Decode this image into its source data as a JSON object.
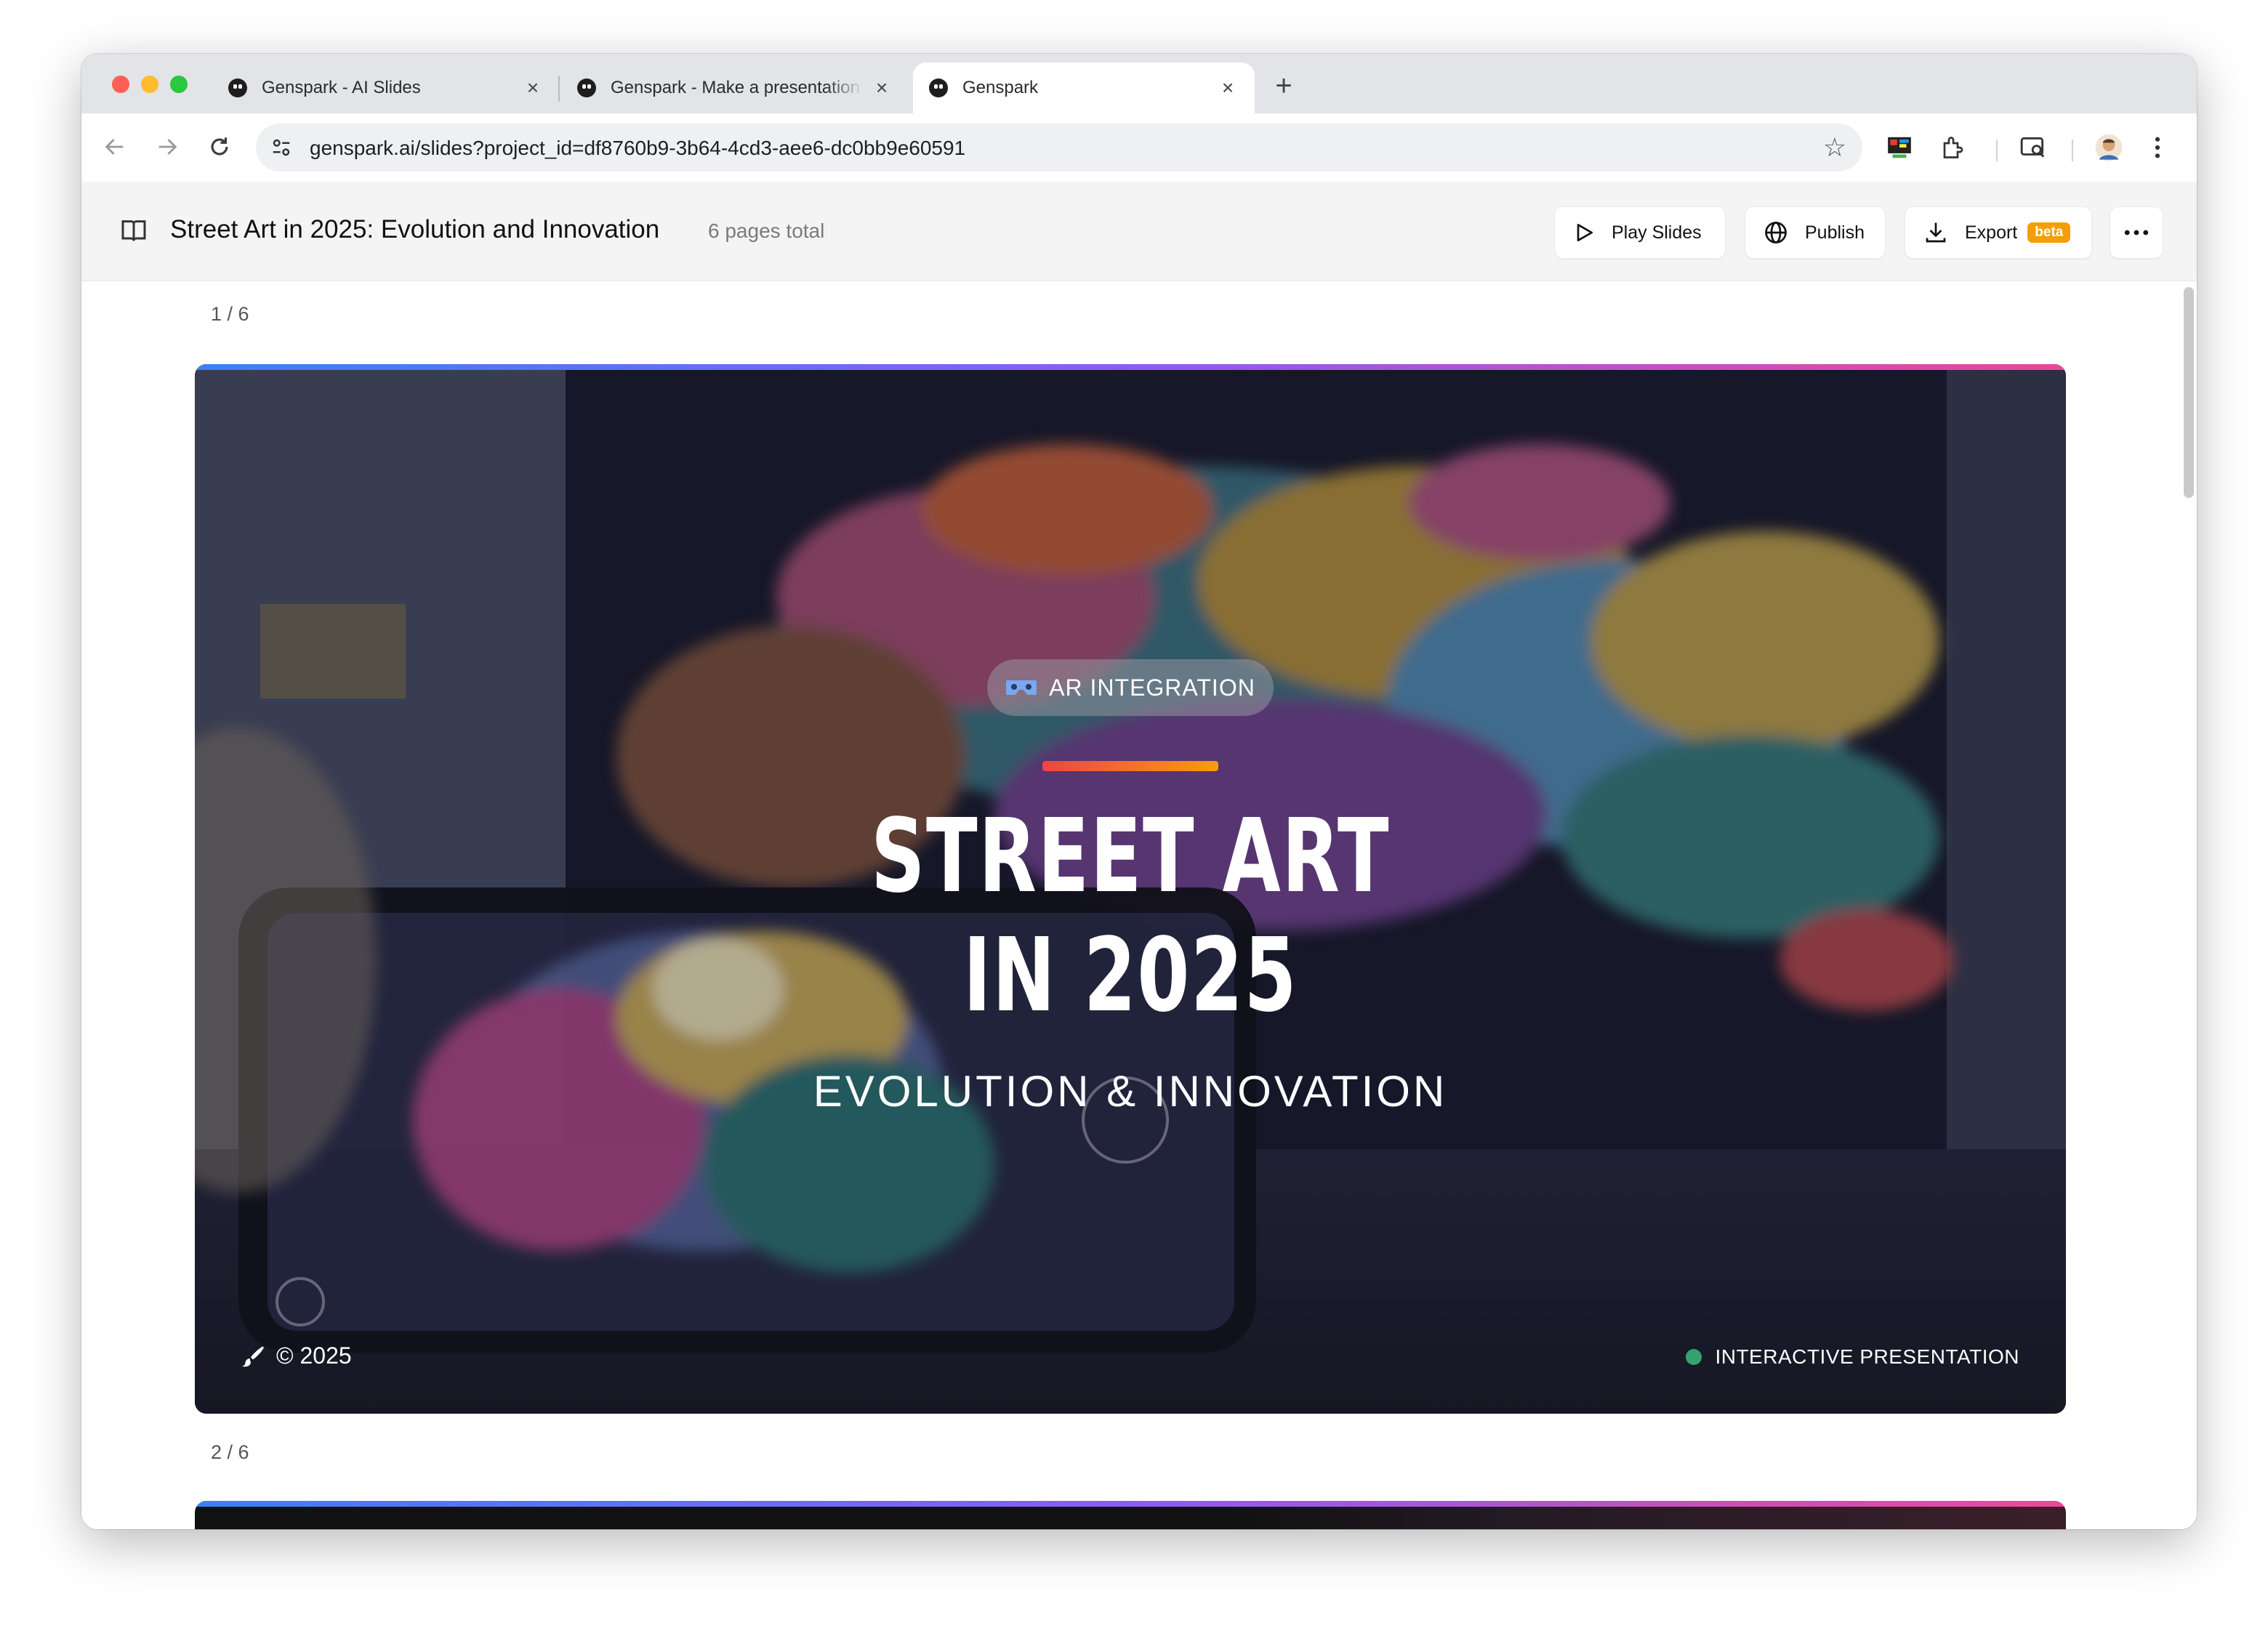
{
  "browser": {
    "tabs": [
      {
        "title": "Genspark - AI Slides"
      },
      {
        "title": "Genspark - Make a presentation"
      },
      {
        "title": "Genspark"
      }
    ],
    "new_tab_symbol": "+",
    "close_symbol": "×",
    "url": "genspark.ai/slides?project_id=df8760b9-3b64-4cd3-aee6-dc0bb9e60591"
  },
  "app": {
    "title": "Street Art in 2025: Evolution and Innovation",
    "pages_total": "6 pages total",
    "buttons": {
      "play": "Play Slides",
      "publish": "Publish",
      "export": "Export",
      "export_badge": "beta"
    }
  },
  "slides": [
    {
      "page_label": "1 / 6",
      "pill_label": "AR INTEGRATION",
      "headline_line1": "STREET ART",
      "headline_line2": "IN 2025",
      "subtitle": "EVOLUTION & INNOVATION",
      "footer_left": "© 2025",
      "footer_right": "INTERACTIVE PRESENTATION"
    },
    {
      "page_label": "2 / 6"
    }
  ],
  "colors": {
    "accent_gradient_start": "#3b82f6",
    "accent_gradient_end": "#ec4899",
    "title_bar_start": "#ef4444",
    "title_bar_end": "#f59e0b",
    "export_badge": "#f59e0b",
    "status_dot": "#34a26f"
  },
  "icons": [
    "back-arrow-icon",
    "forward-arrow-icon",
    "reload-icon",
    "site-settings-icon",
    "star-icon",
    "extension-icon",
    "puzzle-icon",
    "tab-search-icon",
    "profile-avatar",
    "kebab-menu-icon",
    "book-icon",
    "play-icon",
    "globe-icon",
    "download-icon",
    "more-icon",
    "vr-headset-icon",
    "paintbrush-icon"
  ]
}
